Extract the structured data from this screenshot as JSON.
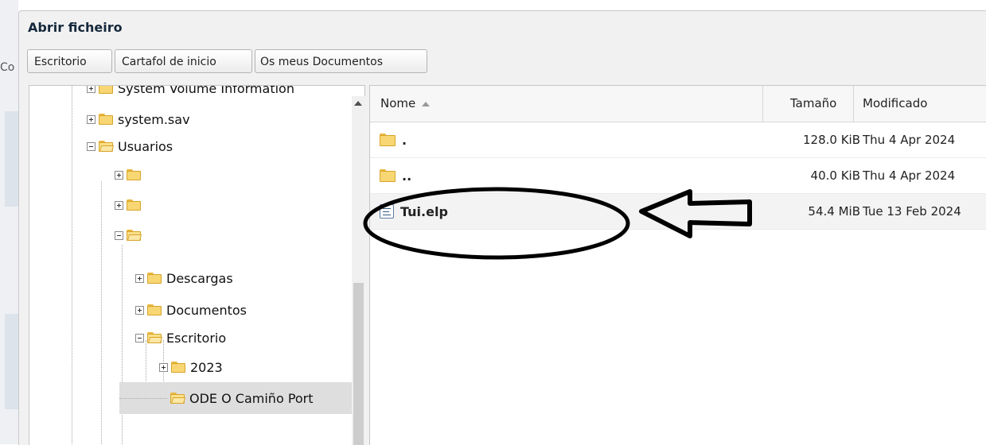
{
  "background": {
    "fragment": "Co"
  },
  "dialog": {
    "title": "Abrir ficheiro"
  },
  "bookmarks": [
    "Escritorio",
    "Cartafol de inicio",
    "Os meus Documentos"
  ],
  "tree": {
    "nodes": [
      {
        "label": "System Volume Information",
        "toggle": "plus"
      },
      {
        "label": "system.sav",
        "toggle": "plus"
      },
      {
        "label": "Usuarios",
        "toggle": "minus"
      },
      {
        "label": "",
        "toggle": "plus"
      },
      {
        "label": "",
        "toggle": "plus"
      },
      {
        "label": "",
        "toggle": "minus"
      },
      {
        "label": "Descargas",
        "toggle": "plus"
      },
      {
        "label": "Documentos",
        "toggle": "plus"
      },
      {
        "label": "Escritorio",
        "toggle": "minus"
      },
      {
        "label": "2023",
        "toggle": "plus"
      },
      {
        "label": "ODE O Camiño Port",
        "toggle": "none",
        "selected": true
      }
    ]
  },
  "files": {
    "columns": {
      "name": "Nome",
      "size": "Tamaño",
      "modified": "Modificado"
    },
    "rows": [
      {
        "name": ".",
        "type": "folder",
        "size": "128.0 KiB",
        "modified": "Thu 4 Apr 2024"
      },
      {
        "name": "..",
        "type": "folder",
        "size": "40.0 KiB",
        "modified": "Thu 4 Apr 2024"
      },
      {
        "name": "Tui.elp",
        "type": "file",
        "size": "54.4 MiB",
        "modified": "Tue 13 Feb 2024"
      }
    ]
  },
  "colors": {
    "folder": "#f8d673",
    "selected": "#dedede",
    "title": "#15283c"
  }
}
